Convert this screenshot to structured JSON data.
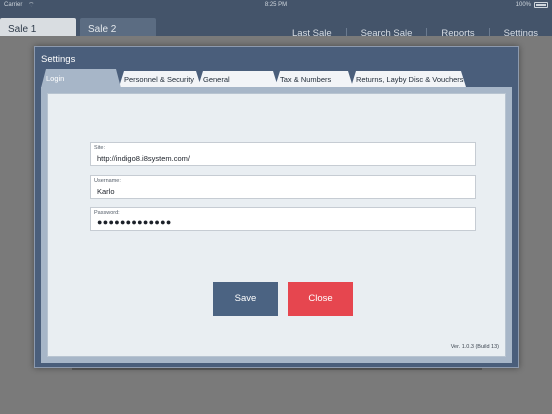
{
  "statusbar": {
    "carrier": "Carrier",
    "time": "8:25 PM",
    "battery": "100%"
  },
  "topbar": {
    "sale_tabs": [
      "Sale 1",
      "Sale 2"
    ],
    "nav": [
      "Last Sale",
      "Search Sale",
      "Reports",
      "Settings"
    ]
  },
  "dialog": {
    "title": "Settings",
    "tabs": [
      "Login",
      "Personnel & Security",
      "General",
      "Tax & Numbers",
      "Returns, Layby Disc & Vouchers"
    ],
    "active_tab": "Login",
    "fields": {
      "site": {
        "label": "Site:",
        "value": "http://indigo8.i8system.com/"
      },
      "username": {
        "label": "Username:",
        "value": "Karlo"
      },
      "password": {
        "label": "Password:",
        "value": "●●●●●●●●●●●●●"
      }
    },
    "buttons": {
      "save": "Save",
      "close": "Close"
    },
    "version": "Ver. 1.0.3 (Build 13)"
  },
  "colors": {
    "topbar": "#44546a",
    "dialog": "#4a5e7b",
    "save_button": "#4b6382",
    "close_button": "#e6464f"
  }
}
